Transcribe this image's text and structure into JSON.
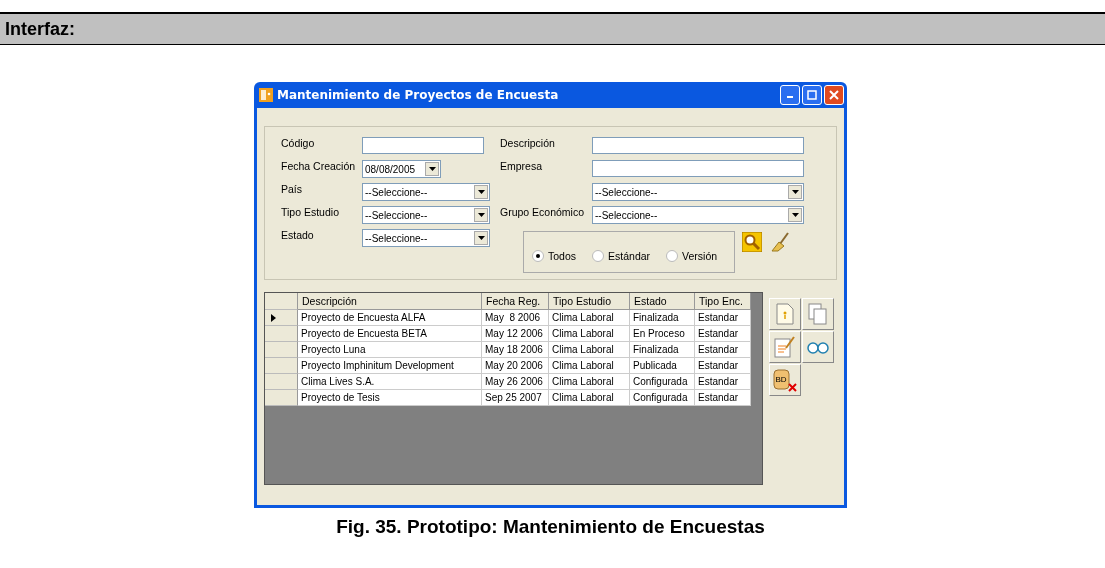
{
  "section_header": "Interfaz:",
  "window": {
    "title": "Mantenimiento de Proyectos de Encuesta",
    "left_fields": [
      {
        "label": "Código",
        "kind": "text"
      },
      {
        "label": "Fecha Creación",
        "kind": "date",
        "value": "08/08/2005"
      },
      {
        "label": "País",
        "kind": "select",
        "value": "--Seleccione--"
      },
      {
        "label": "Tipo Estudio",
        "kind": "select",
        "value": "--Seleccione--"
      },
      {
        "label": "Estado",
        "kind": "select",
        "value": "--Seleccione--"
      }
    ],
    "right_fields": [
      {
        "label": "Descripción",
        "kind": "text"
      },
      {
        "label": "Empresa",
        "kind": "text"
      },
      {
        "kind": "select",
        "value": "--Seleccione--"
      },
      {
        "label": "Grupo Económico",
        "kind": "select",
        "value": "--Seleccione--"
      }
    ],
    "radios": [
      {
        "label": "Todos",
        "selected": true
      },
      {
        "label": "Estándar",
        "selected": false
      },
      {
        "label": "Versión",
        "selected": false
      }
    ],
    "table": {
      "columns": [
        "Descripción",
        "Fecha Reg.",
        "Tipo Estudio",
        "Estado",
        "Tipo Enc."
      ],
      "rows": [
        {
          "selected": true,
          "cells": [
            "Proyecto de Encuesta ALFA",
            "May  8 2006",
            "Clima Laboral",
            "Finalizada",
            "Estandar"
          ]
        },
        {
          "selected": false,
          "cells": [
            "Proyecto de Encuesta BETA",
            "May 12 2006",
            "Clima Laboral",
            "En Proceso",
            "Estandar"
          ]
        },
        {
          "selected": false,
          "cells": [
            "Proyecto Luna",
            "May 18 2006",
            "Clima Laboral",
            "Finalizada",
            "Estandar"
          ]
        },
        {
          "selected": false,
          "cells": [
            "Proyecto Imphinitum Development",
            "May 20 2006",
            "Clima Laboral",
            "Publicada",
            "Estandar"
          ]
        },
        {
          "selected": false,
          "cells": [
            "Clima Lives S.A.",
            "May 26 2006",
            "Clima Laboral",
            "Configurada",
            "Estandar"
          ]
        },
        {
          "selected": false,
          "cells": [
            "Proyecto de Tesis",
            "Sep 25 2007",
            "Clima Laboral",
            "Configurada",
            "Estandar"
          ]
        }
      ]
    },
    "database_icon_label": "BD"
  },
  "caption": "Fig. 35. Prototipo: Mantenimiento de Encuestas"
}
